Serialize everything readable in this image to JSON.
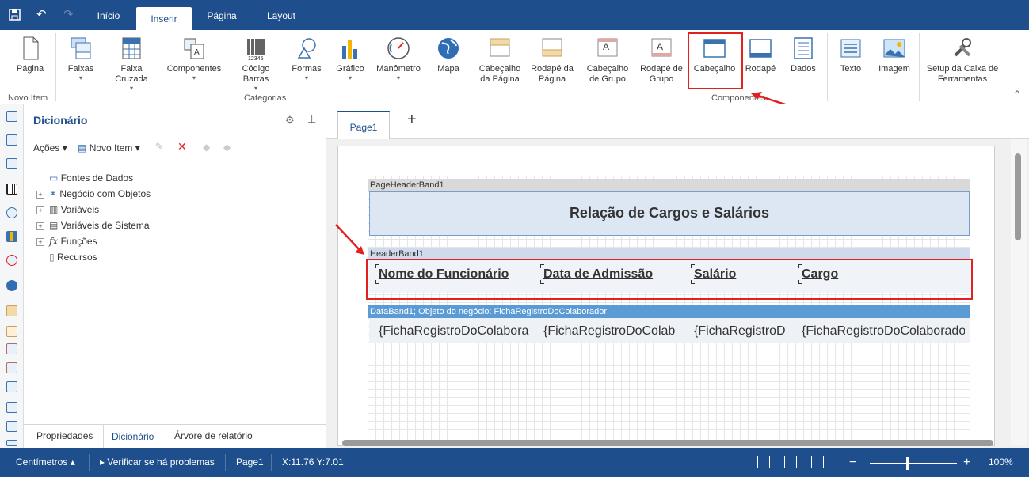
{
  "tabs": [
    "Início",
    "Inserir",
    "Página",
    "Layout"
  ],
  "ribbon": {
    "buttons": [
      "Página",
      "Faixas",
      "Faixa Cruzada",
      "Componentes",
      "Código Barras",
      "Formas",
      "Gráfico",
      "Manômetro",
      "Mapa",
      "Cabeçalho da Página",
      "Rodapé da Página",
      "Cabeçalho de Grupo",
      "Rodapé de Grupo",
      "Cabeçalho",
      "Rodapé",
      "Dados",
      "Texto",
      "Imagem",
      "Setup da Caixa de Ferramentas"
    ],
    "groups": [
      "Novo Item",
      "Categorias",
      "Componentes"
    ]
  },
  "dictionary": {
    "title": "Dicionário",
    "actions": "Ações",
    "new_item": "Novo Item",
    "tree": [
      "Fontes de Dados",
      "Negócio com Objetos",
      "Variáveis",
      "Variáveis de Sistema",
      "Funções",
      "Recursos"
    ],
    "func_prefix": "fx"
  },
  "bottom_tabs": [
    "Propriedades",
    "Dicionário",
    "Árvore de relatório"
  ],
  "page_tab": "Page1",
  "add_tab": "+",
  "report": {
    "page_header_band": "PageHeaderBand1",
    "title": "Relação de Cargos e Salários",
    "header_band": "HeaderBand1",
    "headers": [
      "Nome do Funcionário",
      "Data de Admissão",
      "Salário",
      "Cargo"
    ],
    "data_band": "DataBand1; Objeto do negócio: FichaRegistroDoColaborador",
    "data_fields": [
      "{FichaRegistroDoColabora",
      "{FichaRegistroDoColab",
      "{FichaRegistroD",
      "{FichaRegistroDoColaborado"
    ]
  },
  "status": {
    "units": "Centímetros",
    "check": "Verificar se há problemas",
    "page": "Page1",
    "coords": "X:11.76 Y:7.01",
    "zoom": "100%"
  },
  "colors": {
    "accent": "#1f4e8c",
    "highlight": "#e31f1f",
    "band": "#5b9bd5"
  }
}
